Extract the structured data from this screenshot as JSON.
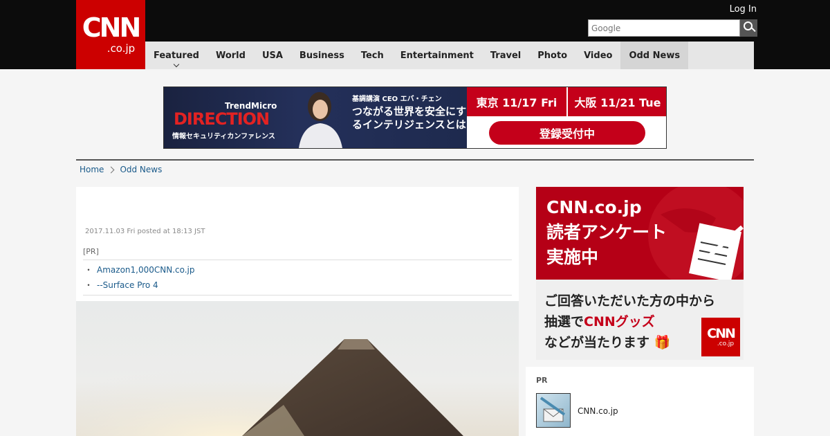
{
  "header": {
    "logo_main": "CNN",
    "logo_sub": ".co.jp",
    "login_label": "Log In",
    "search_placeholder": "Google"
  },
  "nav": {
    "items": [
      {
        "label": "Featured"
      },
      {
        "label": "World"
      },
      {
        "label": "USA"
      },
      {
        "label": "Business"
      },
      {
        "label": "Tech"
      },
      {
        "label": "Entertainment"
      },
      {
        "label": "Travel"
      },
      {
        "label": "Photo"
      },
      {
        "label": "Video"
      },
      {
        "label": "Odd News"
      }
    ]
  },
  "banner": {
    "brand": "TrendMicro",
    "title": "DIRECTION",
    "subtitle": "情報セキュリティカンファレンス",
    "speaker": "基調講演 CEO エバ・チェン",
    "tagline": "つながる世界を安全にするインテリジェンスとは",
    "date_tokyo": "東京 11/17 Fri",
    "date_osaka": "大阪 11/21 Tue",
    "register": "登録受付中"
  },
  "breadcrumb": {
    "home": "Home",
    "section": "Odd News"
  },
  "article": {
    "date": "2017.11.03 Fri posted at 18:13 JST",
    "pr_label": "[PR]",
    "pr_links": [
      {
        "text": "Amazon1,000CNN.co.jp"
      },
      {
        "text": "--Surface Pro 4"
      }
    ]
  },
  "survey_ad": {
    "line1": "CNN.co.jp",
    "line2": "読者アンケート",
    "line3": "実施中",
    "body1": "ご回答いただいた方の中から",
    "body2_pre": "抽選で",
    "body2_red": "CNNグッズ",
    "body3": "などが当たります",
    "logo_main": "CNN",
    "logo_sub": ".co.jp"
  },
  "sidebar_pr": {
    "label": "PR",
    "item_text": "CNN.co.jp"
  },
  "colors": {
    "brand_red": "#cc0000",
    "header_bg": "#0c0c0c",
    "link": "#1a5a8a"
  }
}
